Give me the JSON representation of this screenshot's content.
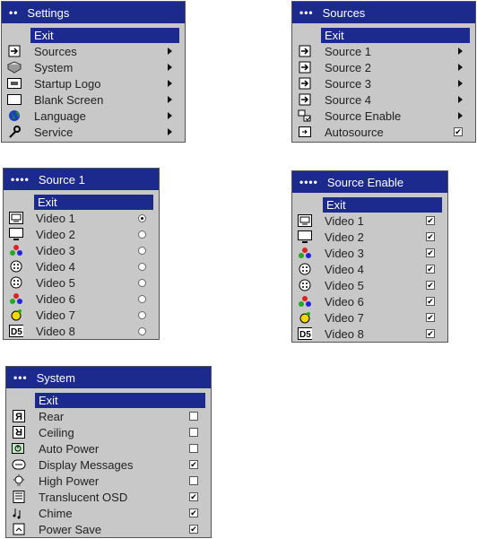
{
  "settings": {
    "title": "Settings",
    "exit": "Exit",
    "items": [
      {
        "label": "Sources",
        "icon": "sources-icon"
      },
      {
        "label": "System",
        "icon": "system-icon"
      },
      {
        "label": "Startup Logo",
        "icon": "logo-icon"
      },
      {
        "label": "Blank Screen",
        "icon": "blank-screen-icon"
      },
      {
        "label": "Language",
        "icon": "globe-icon"
      },
      {
        "label": "Service",
        "icon": "wrench-icon"
      }
    ]
  },
  "sources": {
    "title": "Sources",
    "exit": "Exit",
    "items": [
      {
        "label": "Source 1"
      },
      {
        "label": "Source 2"
      },
      {
        "label": "Source 3"
      },
      {
        "label": "Source 4"
      },
      {
        "label": "Source Enable"
      },
      {
        "label": "Autosource",
        "checked": true
      }
    ]
  },
  "source1": {
    "title": "Source 1",
    "exit": "Exit",
    "items": [
      {
        "label": "Video 1",
        "selected": true
      },
      {
        "label": "Video 2",
        "selected": false
      },
      {
        "label": "Video 3",
        "selected": false
      },
      {
        "label": "Video 4",
        "selected": false
      },
      {
        "label": "Video 5",
        "selected": false
      },
      {
        "label": "Video 6",
        "selected": false
      },
      {
        "label": "Video 7",
        "selected": false
      },
      {
        "label": "Video 8",
        "selected": false
      }
    ]
  },
  "source_enable": {
    "title": "Source Enable",
    "exit": "Exit",
    "items": [
      {
        "label": "Video 1",
        "checked": true
      },
      {
        "label": "Video 2",
        "checked": true
      },
      {
        "label": "Video 3",
        "checked": true
      },
      {
        "label": "Video 4",
        "checked": true
      },
      {
        "label": "Video 5",
        "checked": true
      },
      {
        "label": "Video 6",
        "checked": true
      },
      {
        "label": "Video 7",
        "checked": true
      },
      {
        "label": "Video 8",
        "checked": true
      }
    ]
  },
  "system": {
    "title": "System",
    "exit": "Exit",
    "items": [
      {
        "label": "Rear",
        "checked": false
      },
      {
        "label": "Ceiling",
        "checked": false
      },
      {
        "label": "Auto Power",
        "checked": false
      },
      {
        "label": "Display Messages",
        "checked": true
      },
      {
        "label": "High Power",
        "checked": false
      },
      {
        "label": "Translucent OSD",
        "checked": true
      },
      {
        "label": "Chime",
        "checked": true
      },
      {
        "label": "Power Save",
        "checked": true
      }
    ]
  },
  "video_icons": [
    "rgb-icon",
    "monitor-icon",
    "composite-icon",
    "svideo-icon",
    "svideo-icon",
    "composite-icon",
    "svideo-yellow-icon",
    "d5-icon"
  ],
  "colors": {
    "title_bar": "#1b2a8c",
    "panel": "#c8c8c8"
  }
}
